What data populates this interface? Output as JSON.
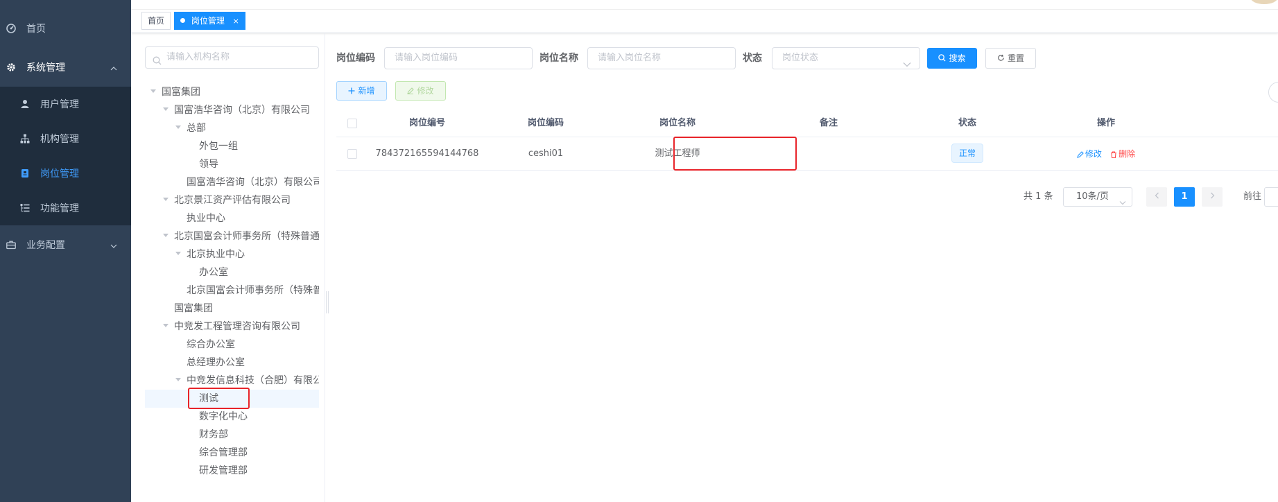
{
  "sidebar": {
    "items": [
      {
        "label": "首页",
        "icon": "dashboard-icon"
      },
      {
        "label": "系统管理",
        "icon": "gear-icon"
      },
      {
        "label": "用户管理",
        "icon": "user-icon"
      },
      {
        "label": "机构管理",
        "icon": "org-tree-icon"
      },
      {
        "label": "岗位管理",
        "icon": "post-icon",
        "active": true
      },
      {
        "label": "功能管理",
        "icon": "tree-table-icon"
      },
      {
        "label": "业务配置",
        "icon": "briefcase-icon"
      }
    ]
  },
  "tags": {
    "home": "首页",
    "current": "岗位管理",
    "close": "×"
  },
  "tree": {
    "search_placeholder": "请输入机构名称",
    "nodes": [
      {
        "label": "国富集团"
      },
      {
        "label": "国富浩华咨询（北京）有限公司"
      },
      {
        "label": "总部"
      },
      {
        "label": "外包一组"
      },
      {
        "label": "领导"
      },
      {
        "label": "国富浩华咨询（北京）有限公司"
      },
      {
        "label": "北京景江资产评估有限公司"
      },
      {
        "label": "执业中心"
      },
      {
        "label": "北京国富会计师事务所（特殊普通合伙）"
      },
      {
        "label": "北京执业中心"
      },
      {
        "label": "办公室"
      },
      {
        "label": "北京国富会计师事务所（特殊普通合伙）"
      },
      {
        "label": "国富集团"
      },
      {
        "label": "中竞发工程管理咨询有限公司"
      },
      {
        "label": "综合办公室"
      },
      {
        "label": "总经理办公室"
      },
      {
        "label": "中竞发信息科技（合肥）有限公司"
      },
      {
        "label": "测试"
      },
      {
        "label": "数字化中心"
      },
      {
        "label": "财务部"
      },
      {
        "label": "综合管理部"
      },
      {
        "label": "研发管理部"
      }
    ]
  },
  "filters": {
    "code_label": "岗位编码",
    "code_placeholder": "请输入岗位编码",
    "name_label": "岗位名称",
    "name_placeholder": "请输入岗位名称",
    "status_label": "状态",
    "status_placeholder": "岗位状态",
    "search_button": "搜索",
    "reset_button": "重置"
  },
  "toolbar": {
    "add_button": "新增",
    "edit_button": "修改"
  },
  "table": {
    "columns": [
      "岗位编号",
      "岗位编码",
      "岗位名称",
      "备注",
      "状态",
      "操作"
    ],
    "rows": [
      {
        "id": "784372165594144768",
        "code": "ceshi01",
        "name": "测试工程师",
        "remark": "",
        "status": "正常",
        "edit": "修改",
        "delete": "删除"
      }
    ]
  },
  "pagination": {
    "total": "共 1 条",
    "page_size": "10条/页",
    "current_page": "1",
    "goto_label": "前往"
  },
  "colors": {
    "sidebar_bg": "#304156",
    "primary": "#1890ff",
    "danger": "#ff4949",
    "highlight": "#e8242a"
  }
}
